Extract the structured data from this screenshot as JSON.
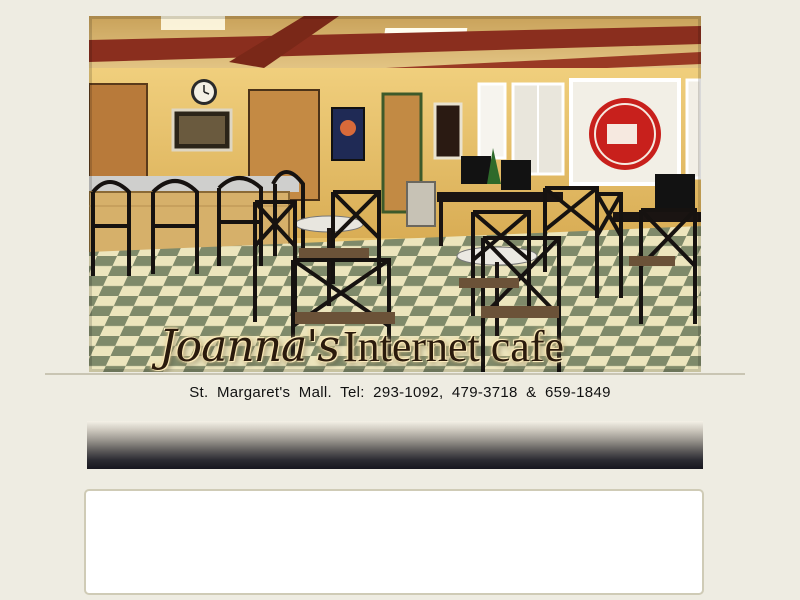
{
  "header": {
    "title_script": "Joanna's",
    "title_block": "Internet cafe"
  },
  "hero_sign": {
    "text": "Joanna's Internet cafe"
  },
  "contact": {
    "text": "St. Margaret's Mall. Tel: 293-1092, 479-3718 & 659-1849"
  },
  "colors": {
    "page_background": "#eeece2",
    "wall": "#e8c26a",
    "beams": "#8a2e1e",
    "floor_light": "#ece5bd",
    "floor_dark": "#7f8a6a",
    "sign_red": "#c8201c",
    "nav_dark": "#17171f",
    "content_border": "#cfcbb6"
  },
  "icons": {
    "wall_clock": "clock-icon",
    "window_sign": "cafe-logo-icon"
  }
}
